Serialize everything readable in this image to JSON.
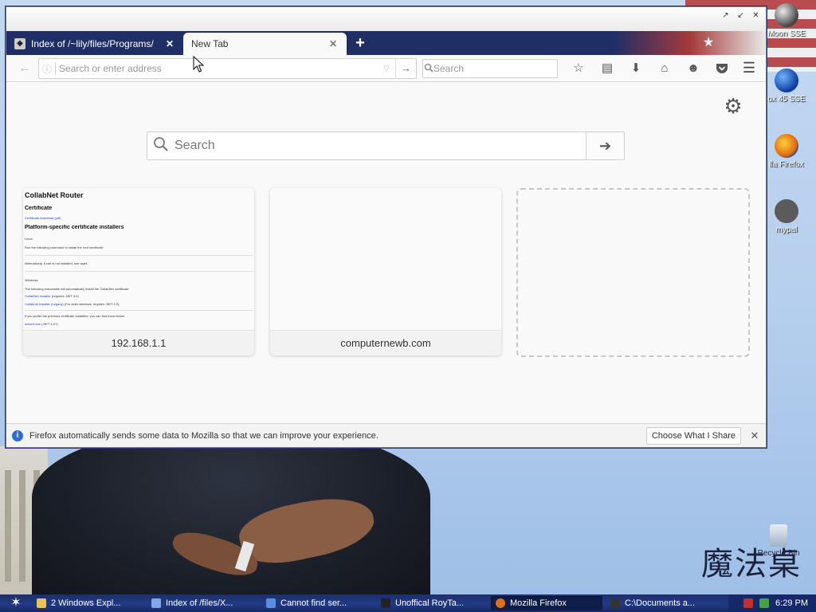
{
  "desktop": {
    "icons": [
      {
        "label": "Moon SSE",
        "icon": "moon-browser-icon"
      },
      {
        "label": "ox 45 SSE",
        "icon": "firefox45-icon"
      },
      {
        "label": "lla Firefox",
        "icon": "firefox-icon"
      },
      {
        "label": "mypal",
        "icon": "mypal-icon"
      },
      {
        "label": "Recycle Bin",
        "icon": "recycle-bin-icon"
      }
    ],
    "logo_text": "魔法桌面"
  },
  "window": {
    "controls": [
      "↗",
      "↙",
      "✕"
    ],
    "tabs": [
      {
        "label": "Index of /~lily/files/Programs/",
        "active": false
      },
      {
        "label": "New Tab",
        "active": true
      }
    ],
    "new_tab_symbol": "+",
    "urlbar": {
      "placeholder": "Search or enter address",
      "value": ""
    },
    "searchbar": {
      "placeholder": "Search"
    },
    "toolbar_icons": [
      "bookmark-star-icon",
      "reading-list-icon",
      "download-icon",
      "home-icon",
      "smiley-feedback-icon",
      "pocket-icon"
    ],
    "menu_symbol": "☰"
  },
  "newtab": {
    "search_placeholder": "Search",
    "tiles": [
      {
        "title": "192.168.1.1",
        "has_thumbnail": true
      },
      {
        "title": "computernewb.com",
        "has_thumbnail": false
      }
    ],
    "thumb": {
      "h1": "CollabNet Router",
      "h2a": "Certificate",
      "link1": "Certificate download (pdf)",
      "h2b": "Platform-specific certificate installers",
      "p1": "Linux:",
      "p2": "Run the following command to install the root certificate:",
      "p3": "Alternatively, if curl is not installed, use wget:",
      "p4": "Windows:",
      "p5": "The following executable will automatically install the CollabNet certificate:",
      "link2": "CollabNet Installer",
      "link2_suffix": " (requires .NET 4.0)",
      "link3": "Collabnet Installer (Legacy)",
      "link3_suffix": " (For older windows, requires .NET 2.0)",
      "p6": "If you prefer the previous certificate installers, you can find them below:",
      "link4": "netcert.exe",
      "link4_suffix": " (.NET 4.0+)"
    }
  },
  "notification": {
    "message": "Firefox automatically sends some data to Mozilla so that we can improve your experience.",
    "button": "Choose What I Share"
  },
  "taskbar": {
    "tasks": [
      {
        "label": "2 Windows Expl...",
        "active": false,
        "color": "#e8c25a"
      },
      {
        "label": "Index of /files/X...",
        "active": false,
        "color": "#7fa7e6"
      },
      {
        "label": "Cannot find ser...",
        "active": false,
        "color": "#5a8fe0"
      },
      {
        "label": "Unoffical RoyTa...",
        "active": false,
        "color": "#222222"
      },
      {
        "label": "Mozilla Firefox",
        "active": true,
        "color": "#e0701c"
      },
      {
        "label": "C:\\Documents a...",
        "active": false,
        "color": "#333333"
      }
    ],
    "clock": "6:29 PM"
  }
}
